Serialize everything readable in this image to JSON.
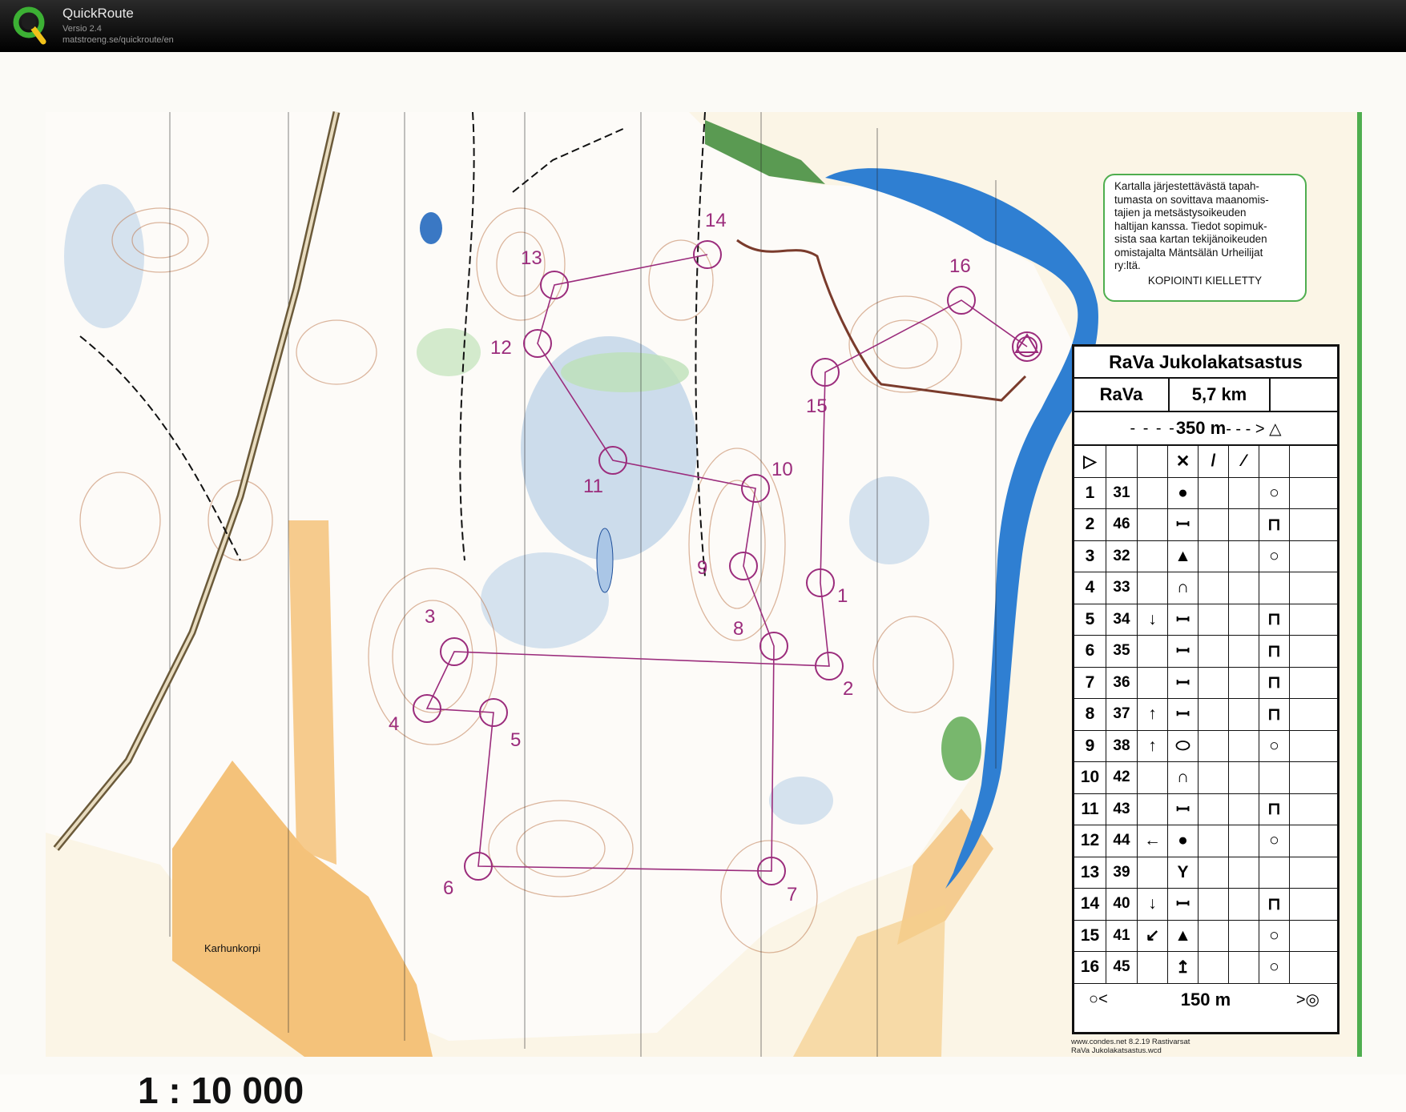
{
  "app": {
    "title": "QuickRoute",
    "version": "Versio 2.4",
    "url": "matstroeng.se/quickroute/en"
  },
  "map": {
    "scale": "1 : 10 000",
    "place_name": "Karhunkorpi",
    "notice_lines": [
      "Kartalla järjestettävästä tapah-",
      "tumasta on sovittava maanomis-",
      "tajien ja metsästysoikeuden",
      "haltijan kanssa. Tiedot sopimuk-",
      "sista saa kartan tekijänoikeuden",
      "omistajalta  Mäntsälän Urheilijat",
      "ry:ltä."
    ],
    "notice_footer": "KOPIOINTI KIELLETTY",
    "course_color": "#9b2c7c",
    "controls": [
      {
        "num": "1"
      },
      {
        "num": "2"
      },
      {
        "num": "3"
      },
      {
        "num": "4"
      },
      {
        "num": "5"
      },
      {
        "num": "6"
      },
      {
        "num": "7"
      },
      {
        "num": "8"
      },
      {
        "num": "9"
      },
      {
        "num": "10"
      },
      {
        "num": "11"
      },
      {
        "num": "12"
      },
      {
        "num": "13"
      },
      {
        "num": "14"
      },
      {
        "num": "15"
      },
      {
        "num": "16"
      }
    ]
  },
  "description_sheet": {
    "title": "RaVa Jukolakatsastus",
    "course": "RaVa",
    "length": "5,7 km",
    "start_distance": "350 m",
    "finish_distance": "150 m",
    "columns_header": [
      "▷",
      "",
      "",
      "✕",
      "/",
      "⁄",
      "",
      ""
    ],
    "rows": [
      {
        "n": "1",
        "code": "31",
        "dir": "",
        "feature": "●",
        "pos": "○"
      },
      {
        "n": "2",
        "code": "46",
        "dir": "",
        "feature": "ꟷ",
        "pos": "⊓"
      },
      {
        "n": "3",
        "code": "32",
        "dir": "",
        "feature": "▲",
        "pos": "○"
      },
      {
        "n": "4",
        "code": "33",
        "dir": "",
        "feature": "∩",
        "pos": ""
      },
      {
        "n": "5",
        "code": "34",
        "dir": "↓",
        "feature": "ꟷ",
        "pos": "⊓"
      },
      {
        "n": "6",
        "code": "35",
        "dir": "",
        "feature": "ꟷ",
        "pos": "⊓"
      },
      {
        "n": "7",
        "code": "36",
        "dir": "",
        "feature": "ꟷ",
        "pos": "⊓"
      },
      {
        "n": "8",
        "code": "37",
        "dir": "↑",
        "feature": "ꟷ",
        "pos": "⊓"
      },
      {
        "n": "9",
        "code": "38",
        "dir": "↑",
        "feature": "⬭",
        "pos": "○"
      },
      {
        "n": "10",
        "code": "42",
        "dir": "",
        "feature": "∩",
        "pos": ""
      },
      {
        "n": "11",
        "code": "43",
        "dir": "",
        "feature": "ꟷ",
        "pos": "⊓"
      },
      {
        "n": "12",
        "code": "44",
        "dir": "←",
        "feature": "●",
        "pos": "○"
      },
      {
        "n": "13",
        "code": "39",
        "dir": "",
        "feature": "Y",
        "pos": ""
      },
      {
        "n": "14",
        "code": "40",
        "dir": "↓",
        "feature": "ꟷ",
        "pos": "⊓"
      },
      {
        "n": "15",
        "code": "41",
        "dir": "↙",
        "feature": "▲",
        "pos": "○"
      },
      {
        "n": "16",
        "code": "45",
        "dir": "",
        "feature": "↥",
        "pos": "○"
      }
    ],
    "footer_lines": [
      "www.condes.net 8.2.19 Rastivarsat",
      "RaVa Jukolakatsastus.wcd"
    ]
  }
}
